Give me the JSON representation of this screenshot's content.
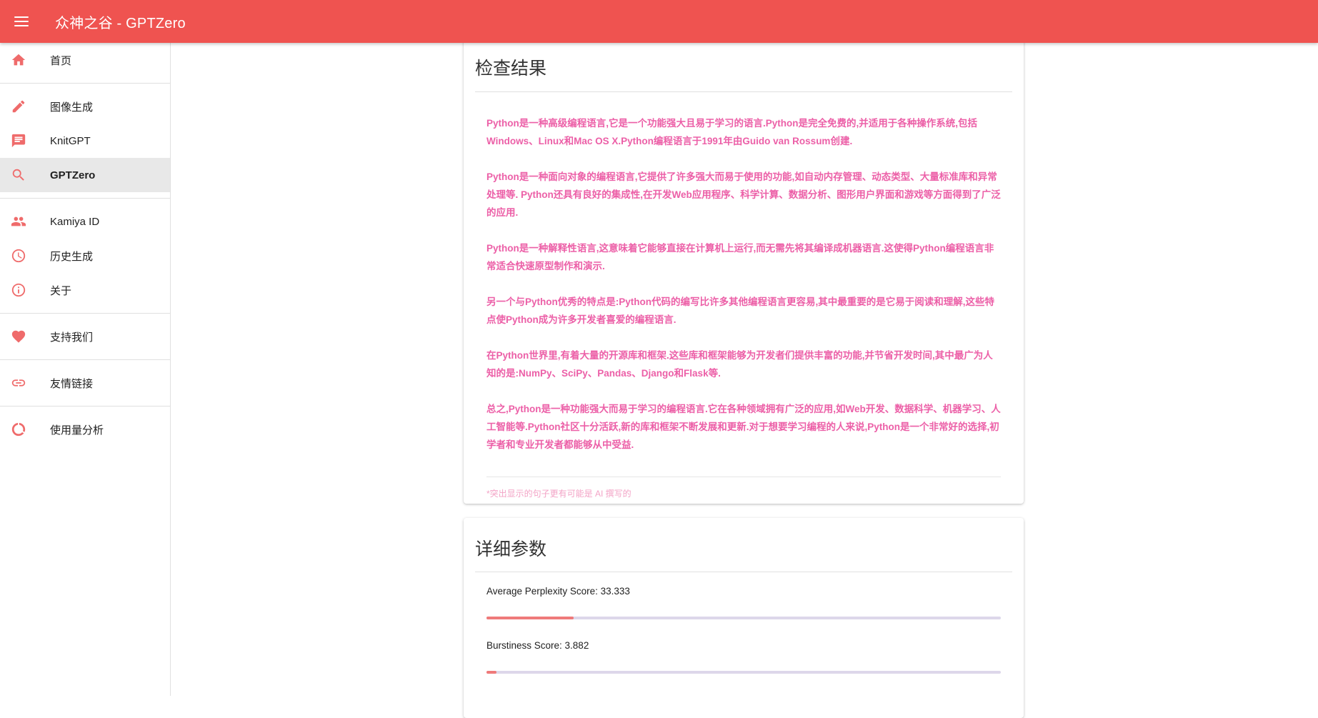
{
  "app": {
    "title": "众神之谷 - GPTZero"
  },
  "colors": {
    "brand": "#ef5350",
    "icon": "#ef6b6b",
    "highlight_text": "#ec5fa7",
    "footnote": "#f3a3c6",
    "bar_fill": "#ef7a7a",
    "bar_track": "#ddd7ea"
  },
  "sidebar": {
    "items": [
      {
        "label": "首页",
        "icon": "home-icon"
      },
      {
        "label": "图像生成",
        "icon": "pencil-icon"
      },
      {
        "label": "KnitGPT",
        "icon": "chat-icon"
      },
      {
        "label": "GPTZero",
        "icon": "search-icon",
        "active": true
      },
      {
        "label": "Kamiya ID",
        "icon": "people-icon"
      },
      {
        "label": "历史生成",
        "icon": "clock-icon"
      },
      {
        "label": "关于",
        "icon": "info-icon"
      },
      {
        "label": "支持我们",
        "icon": "heart-icon"
      },
      {
        "label": "友情链接",
        "icon": "link-icon"
      },
      {
        "label": "使用量分析",
        "icon": "donut-chart-icon"
      }
    ]
  },
  "result": {
    "title": "检查结果",
    "paragraphs": [
      "Python是一种高级编程语言,它是一个功能强大且易于学习的语言.Python是完全免费的,并适用于各种操作系统,包括Windows、Linux和Mac OS X.Python编程语言于1991年由Guido van Rossum创建.",
      "Python是一种面向对象的编程语言,它提供了许多强大而易于使用的功能,如自动内存管理、动态类型、大量标准库和异常处理等. Python还具有良好的集成性,在开发Web应用程序、科学计算、数据分析、图形用户界面和游戏等方面得到了广泛的应用.",
      "Python是一种解释性语言,这意味着它能够直接在计算机上运行,而无需先将其编译成机器语言.这使得Python编程语言非常适合快速原型制作和演示.",
      "另一个与Python优秀的特点是:Python代码的编写比许多其他编程语言更容易,其中最重要的是它易于阅读和理解,这些特点使Python成为许多开发者喜爱的编程语言.",
      "在Python世界里,有着大量的开源库和框架.这些库和框架能够为开发者们提供丰富的功能,并节省开发时间,其中最广为人知的是:NumPy、SciPy、Pandas、Django和Flask等.",
      "总之,Python是一种功能强大而易于学习的编程语言.它在各种领域拥有广泛的应用,如Web开发、数据科学、机器学习、人工智能等.Python社区十分活跃,新的库和框架不断发展和更新.对于想要学习编程的人来说,Python是一个非常好的选择,初学者和专业开发者都能够从中受益."
    ],
    "footnote": "*突出显示的句子更有可能是 AI 撰写的"
  },
  "params": {
    "title": "详细参数",
    "items": [
      {
        "label": "Average Perplexity Score: 33.333",
        "fraction": 0.17
      },
      {
        "label": "Burstiness Score: 3.882",
        "fraction": 0.02
      }
    ]
  }
}
